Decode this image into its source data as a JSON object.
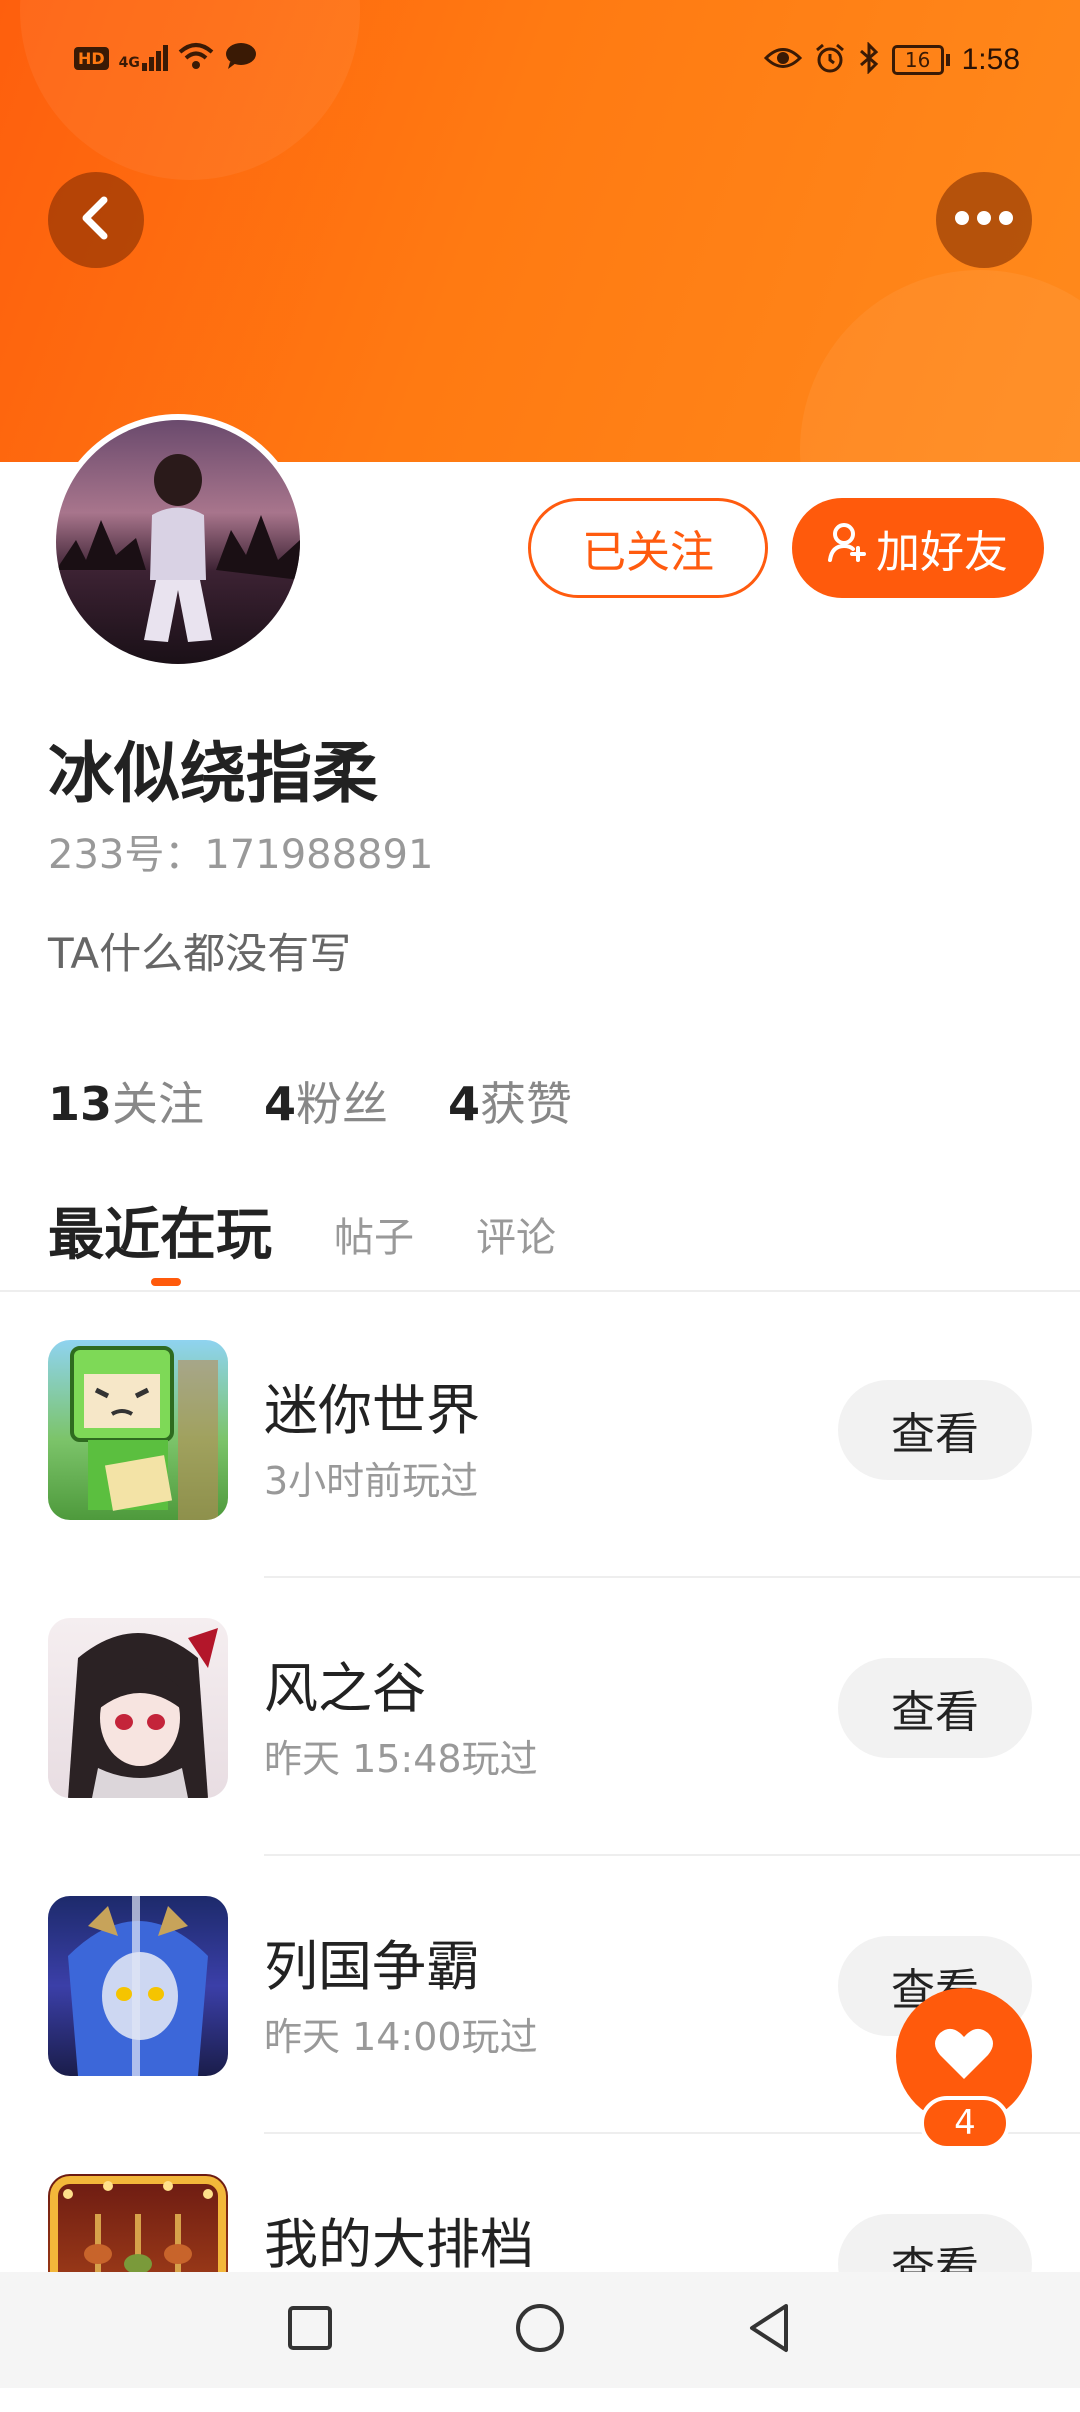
{
  "status_bar": {
    "left_labels": [
      "HD",
      "4G"
    ],
    "time": "1:58",
    "battery": "16"
  },
  "header": {
    "back_icon": "chevron-left-icon",
    "more_icon": "more-horizontal-icon"
  },
  "profile": {
    "followed_label": "已关注",
    "add_friend_label": "加好友",
    "name": "冰似绕指柔",
    "uid": "233号：171988891",
    "bio": "TA什么都没有写",
    "stats": [
      {
        "num": "13",
        "label": "关注"
      },
      {
        "num": "4",
        "label": "粉丝"
      },
      {
        "num": "4",
        "label": "获赞"
      }
    ]
  },
  "tabs": [
    {
      "label": "最近在玩",
      "active": true
    },
    {
      "label": "帖子",
      "active": false
    },
    {
      "label": "评论",
      "active": false
    }
  ],
  "games": [
    {
      "title": "迷你世界",
      "sub": "3小时前玩过",
      "button": "查看"
    },
    {
      "title": "风之谷",
      "sub": "昨天 15:48玩过",
      "button": "查看"
    },
    {
      "title": "列国争霸",
      "sub": "昨天 14:00玩过",
      "button": "查看"
    },
    {
      "title": "我的大排档",
      "sub": "",
      "button": "查看"
    }
  ],
  "fab": {
    "count": "4"
  },
  "colors": {
    "accent": "#ff5a0c",
    "header": "#ff7a12"
  }
}
